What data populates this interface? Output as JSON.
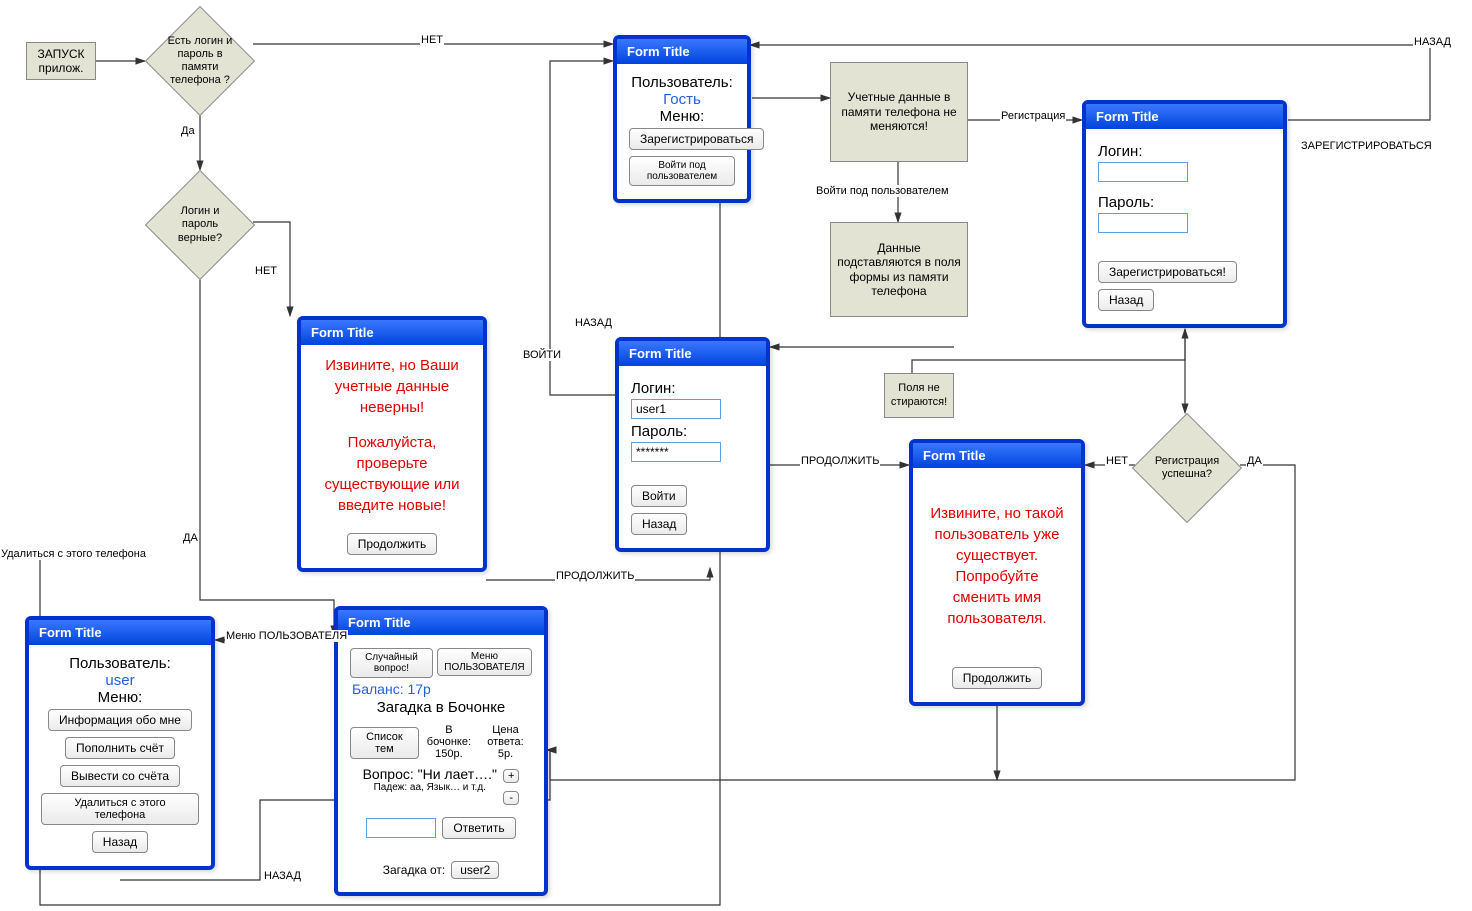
{
  "start": {
    "label": "ЗАПУСК\nприлож."
  },
  "decisions": {
    "d_mem": "Есть логин и пароль в памяти телефона ?",
    "d_valid": "Логин и пароль верные?",
    "d_reg": "Регистрация успешна?"
  },
  "processes": {
    "p_cred": "Учетные данные в памяти телефона не меняются!",
    "p_subst": "Данные подставляются в поля формы из памяти телефона",
    "p_noerase": "Поля не стираются!"
  },
  "edge_labels": {
    "net1": "НЕТ",
    "da1": "Да",
    "net2": "НЕТ",
    "da2": "ДА",
    "nazad1": "НАЗАД",
    "nazad2": "НАЗАД",
    "nazad_top": "НАЗАД",
    "voiti": "ВОЙТИ",
    "voiti_usr": "Войти под пользователем",
    "prodolzhit": "ПРОДОЛЖИТЬ",
    "prodolzhit2": "ПРОДОЛЖИТЬ",
    "registraciya": "Регистрация",
    "zareg": "ЗАРЕГИСТРИРОВАТЬСЯ",
    "net3": "НЕТ",
    "da3": "ДА",
    "menu_user": "Меню ПОЛЬЗОВАТЕЛЯ",
    "udalit": "Удалиться с этого телефона"
  },
  "form_guest": {
    "title": "Form Title",
    "user_label": "Пользователь:",
    "user": "Гость",
    "menu_label": "Меню:",
    "b1": "Зарегистрироваться",
    "b2": "Войти под пользователем"
  },
  "form_err_cred": {
    "title": "Form Title",
    "msg1": "Извините, но Ваши учетные данные неверны!",
    "msg2": "Пожалуйста, проверьте существующие или введите новые!",
    "btn": "Продолжить"
  },
  "form_login": {
    "title": "Form Title",
    "login_label": "Логин:",
    "login_value": "user1",
    "pass_label": "Пароль:",
    "pass_value": "*******",
    "b_enter": "Войти",
    "b_back": "Назад"
  },
  "form_reg": {
    "title": "Form Title",
    "login_label": "Логин:",
    "pass_label": "Пароль:",
    "b_reg": "Зарегистрироваться!",
    "b_back": "Назад"
  },
  "form_err_reg": {
    "title": "Form Title",
    "msg": "Извините, но такой пользователь уже существует. Попробуйте сменить имя пользователя.",
    "btn": "Продолжить"
  },
  "form_user": {
    "title": "Form Title",
    "user_label": "Пользователь:",
    "user": "user",
    "menu_label": "Меню:",
    "b1": "Информация обо мне",
    "b2": "Пополнить счёт",
    "b3": "Вывести со счёта",
    "b4": "Удалиться с этого телефона",
    "b5": "Назад"
  },
  "form_game": {
    "title": "Form Title",
    "b_rand": "Случайный вопрос!",
    "b_menu": "Меню ПОЛЬЗОВАТЕЛЯ",
    "balance": "Баланс: 17р",
    "heading": "Загадка в Бочонке",
    "b_topics": "Список тем",
    "barrel_label": "В бочонке:",
    "barrel_val": "150р.",
    "price_label": "Цена ответа:",
    "price_val": "5р.",
    "question": "Вопрос: \"Ни лает….\"",
    "hint": "Падеж: аа, Язык… и т.д.",
    "plus": "+",
    "minus": "-",
    "b_answer": "Ответить",
    "riddle_from": "Загадка от:",
    "from_user": "user2"
  }
}
